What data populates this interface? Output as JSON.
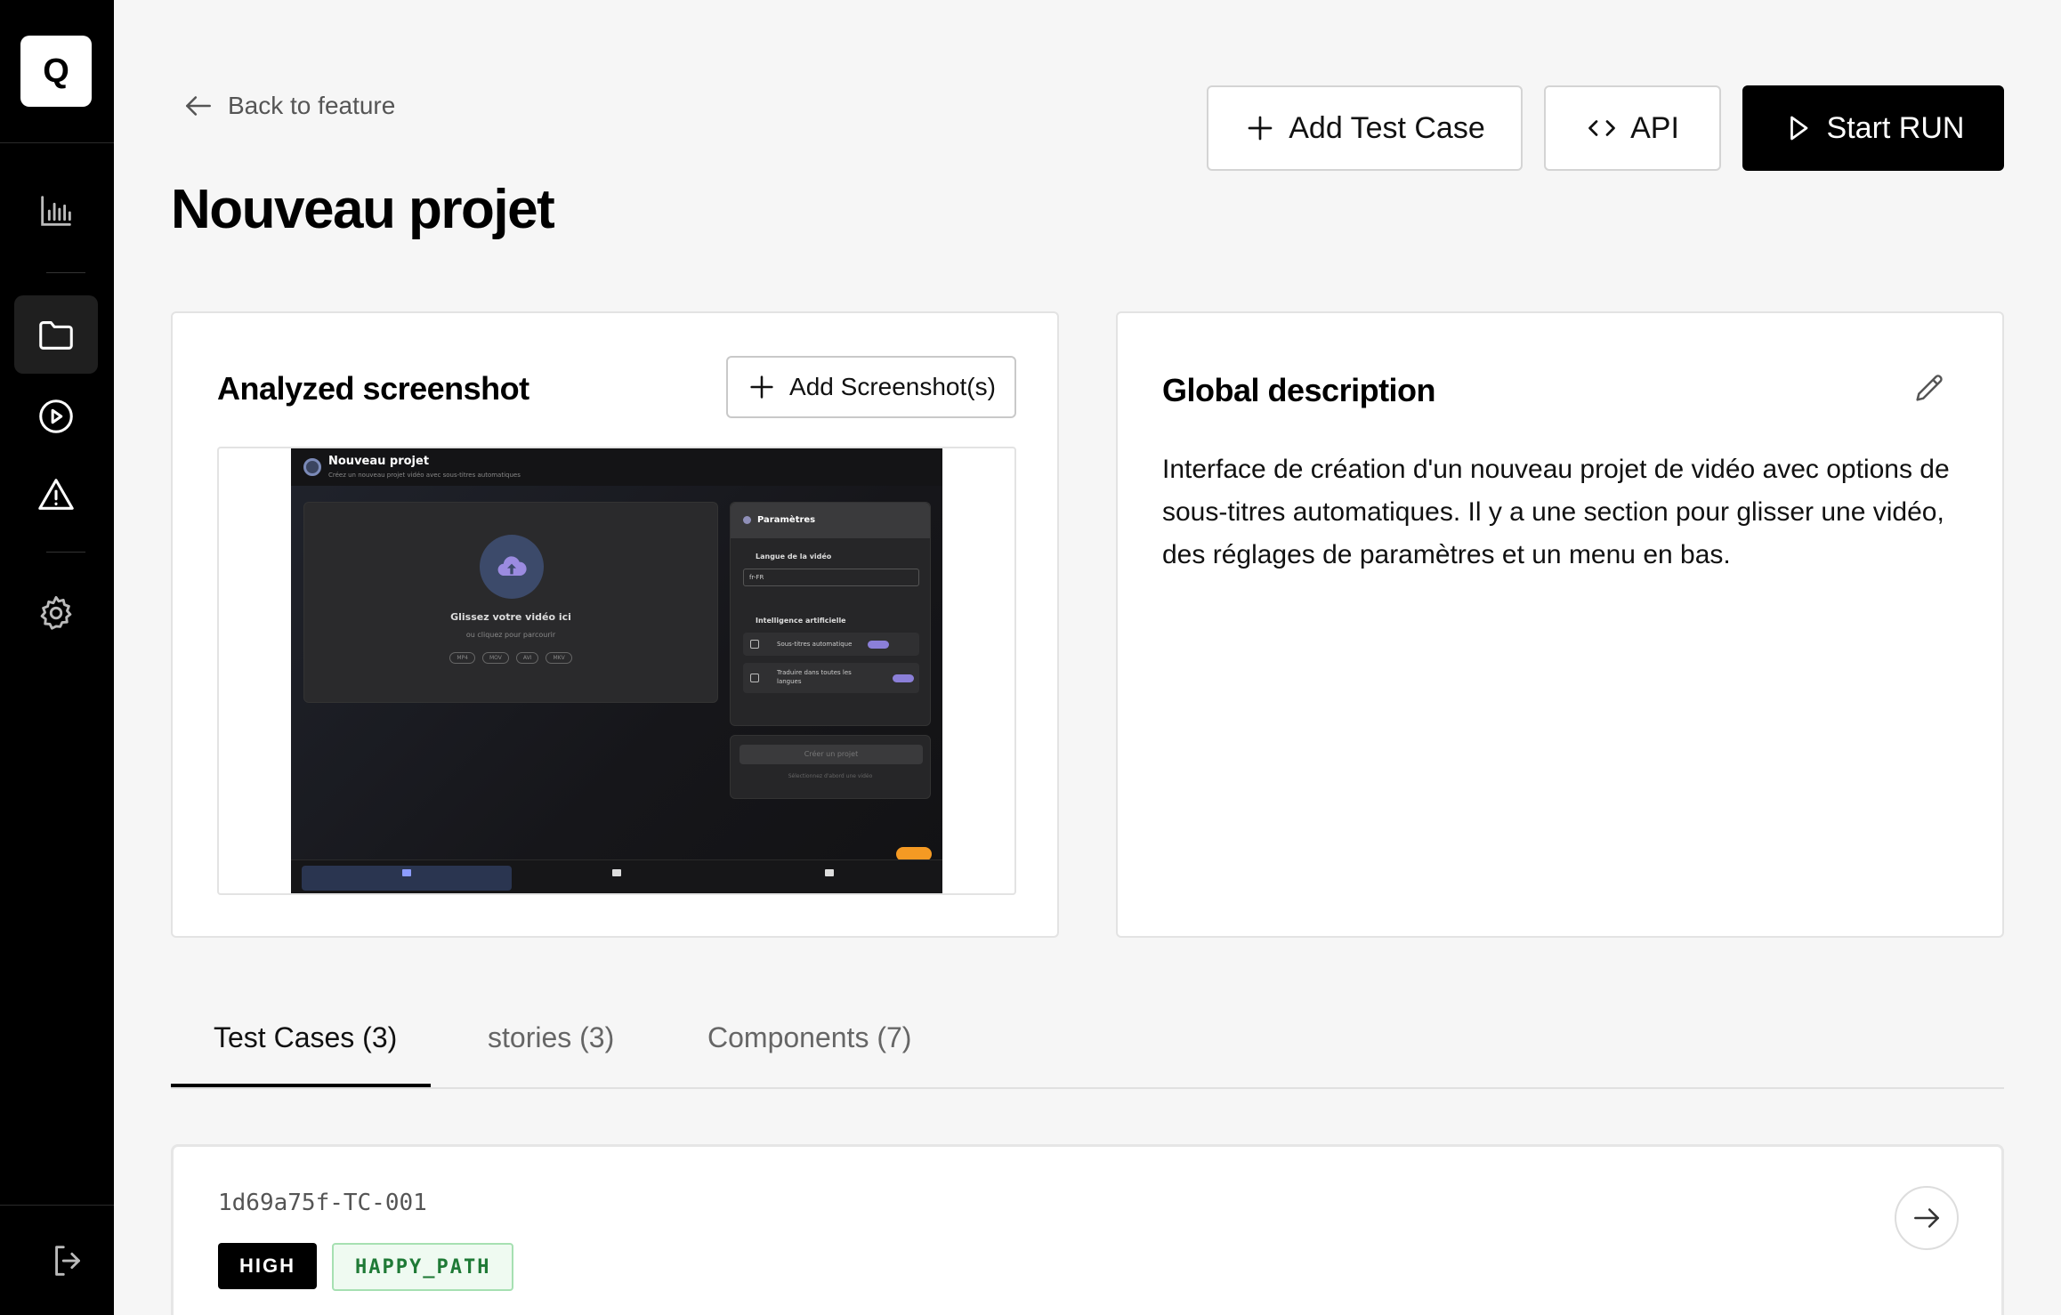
{
  "sidebar": {
    "logo": "Q",
    "items": [
      {
        "icon": "bar-chart-icon"
      },
      {
        "icon": "folder-icon",
        "active": true
      },
      {
        "icon": "play-circle-icon"
      },
      {
        "icon": "warning-icon"
      },
      {
        "icon": "gear-icon"
      }
    ],
    "logout_icon": "logout-icon"
  },
  "header": {
    "back_label": "Back to feature",
    "title": "Nouveau projet",
    "add_test_case_label": "Add Test Case",
    "api_label": "API",
    "start_run_label": "Start RUN"
  },
  "screenshot_card": {
    "title": "Analyzed screenshot",
    "add_label": "Add Screenshot(s)",
    "preview": {
      "title": "Nouveau projet",
      "subtitle": "Créez un nouveau projet vidéo avec sous-titres automatiques",
      "drop_title": "Glissez votre vidéo ici",
      "drop_sub": "ou cliquez pour parcourir",
      "formats": [
        "MP4",
        "MOV",
        "AVI",
        "MKV"
      ],
      "panel_title": "Paramètres",
      "language_label": "Langue de la vidéo",
      "language_value": "fr-FR",
      "ai_label": "Intelligence artificielle",
      "option1": "Sous-titres automatique",
      "option2": "Traduire dans toutes les langues",
      "create_label": "Créer un projet",
      "create_sub": "Sélectionnez d'abord une vidéo"
    }
  },
  "description_card": {
    "title": "Global description",
    "text": "Interface de création d'un nouveau projet de vidéo avec options de sous-titres automatiques. Il y a une section pour glisser une vidéo, des réglages de paramètres et un menu en bas."
  },
  "tabs": [
    {
      "label": "Test Cases (3)",
      "active": true
    },
    {
      "label": "stories (3)",
      "active": false
    },
    {
      "label": "Components (7)",
      "active": false
    }
  ],
  "test_case": {
    "id": "1d69a75f-TC-001",
    "priority": "HIGH",
    "type": "HAPPY_PATH"
  },
  "colors": {
    "sidebar_bg": "#000000",
    "accent_dark": "#000000",
    "happy_path_text": "#1f7a36",
    "happy_path_bg": "#effaf1"
  }
}
